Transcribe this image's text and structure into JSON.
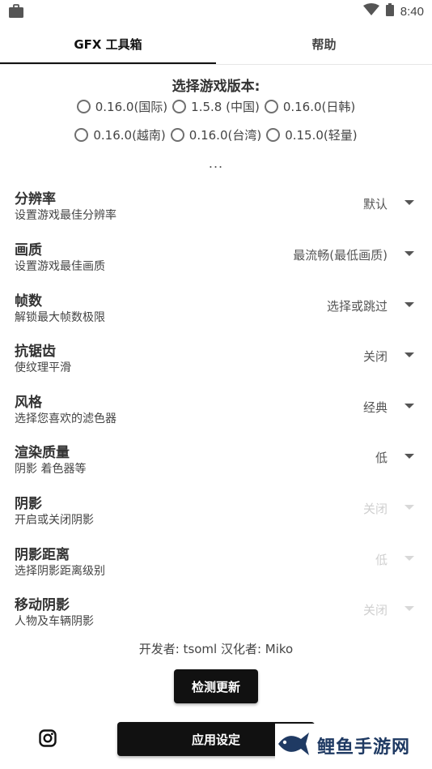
{
  "status": {
    "time": "8:40"
  },
  "tabs": [
    {
      "label": "GFX 工具箱"
    },
    {
      "label": "帮助"
    }
  ],
  "version": {
    "title": "选择游戏版本:",
    "options": [
      "0.16.0(国际)",
      "1.5.8 (中国)",
      "0.16.0(日韩)",
      "0.16.0(越南)",
      "0.16.0(台湾)",
      "0.15.0(轻量)"
    ],
    "more": "..."
  },
  "settings": [
    {
      "title": "分辨率",
      "desc": "设置游戏最佳分辨率",
      "value": "默认"
    },
    {
      "title": "画质",
      "desc": "设置游戏最佳画质",
      "value": "最流畅(最低画质)"
    },
    {
      "title": "帧数",
      "desc": "解锁最大帧数极限",
      "value": "选择或跳过"
    },
    {
      "title": "抗锯齿",
      "desc": "使纹理平滑",
      "value": "关闭"
    },
    {
      "title": "风格",
      "desc": "选择您喜欢的滤色器",
      "value": "经典"
    },
    {
      "title": "渲染质量",
      "desc": "阴影 着色器等",
      "value": "低"
    },
    {
      "title": "阴影",
      "desc": "开启或关闭阴影",
      "value": "关闭"
    },
    {
      "title": "阴影距离",
      "desc": "选择阴影距离级别",
      "value": "低"
    },
    {
      "title": "移动阴影",
      "desc": "人物及车辆阴影",
      "value": "关闭"
    }
  ],
  "credits": "开发者: tsoml 汉化者: Miko",
  "buttons": {
    "check_update": "检测更新",
    "apply": "应用设定"
  },
  "watermark": {
    "text": "鲤鱼手游网"
  },
  "colors": {
    "accent": "#111111",
    "disabled": "#cfcfcf"
  }
}
